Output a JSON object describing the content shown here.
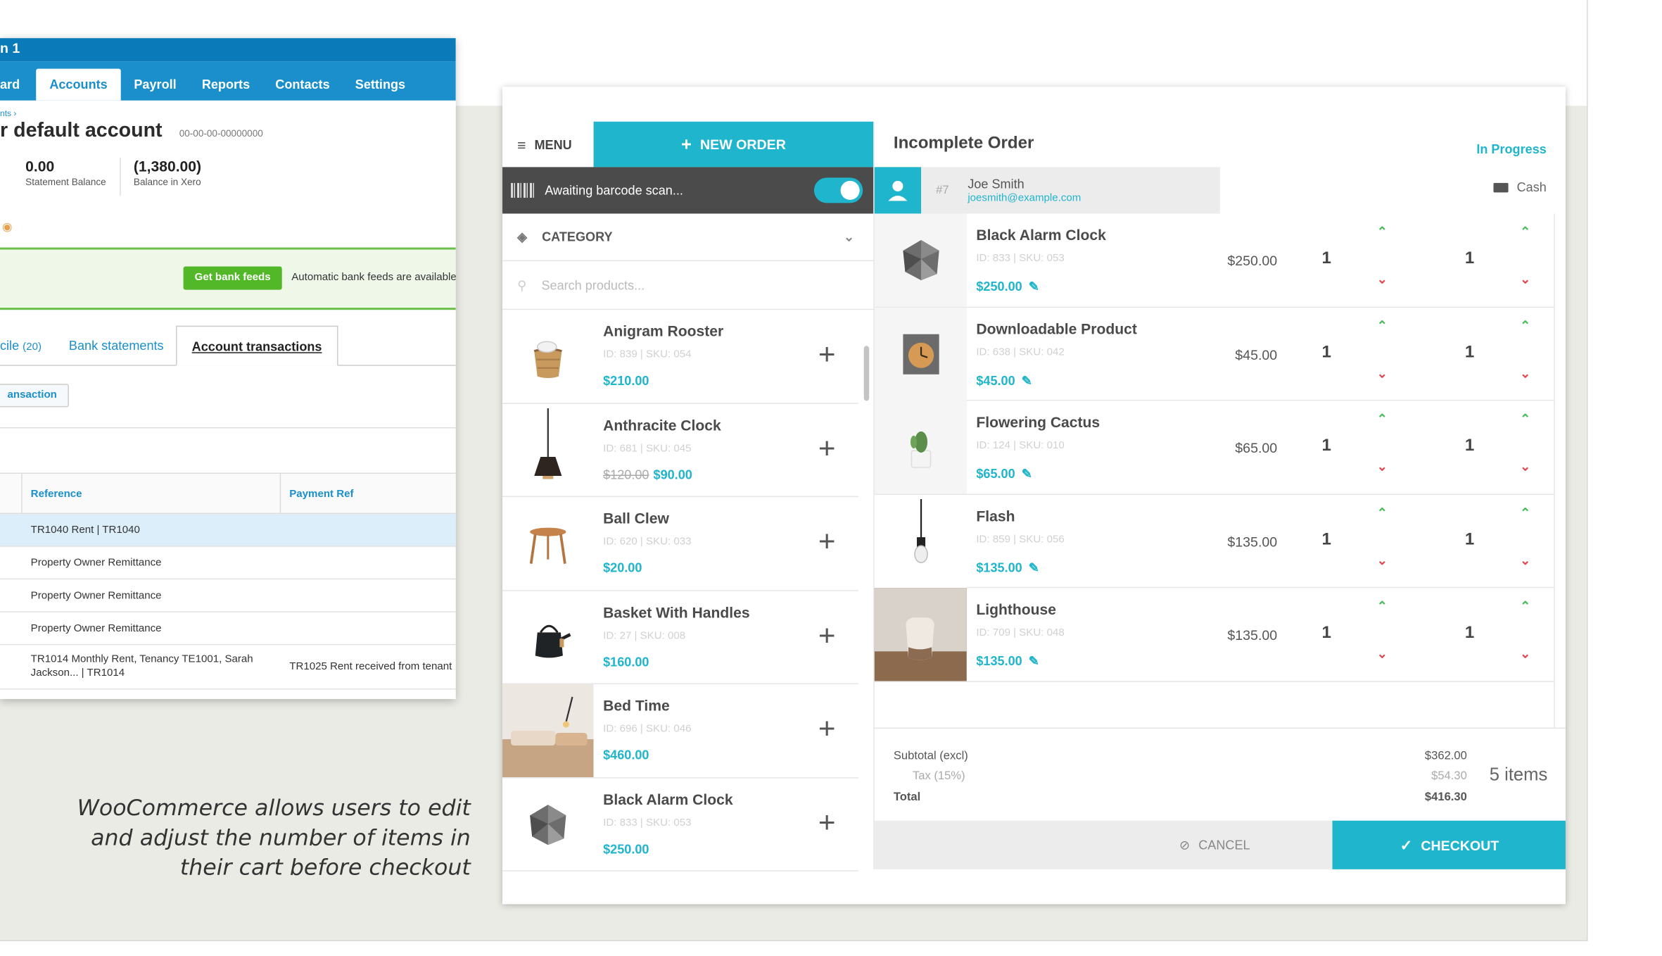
{
  "xero": {
    "window_title": "n 1",
    "nav": [
      "ard",
      "Accounts",
      "Payroll",
      "Reports",
      "Contacts",
      "Settings"
    ],
    "breadcrumb": "nts ›",
    "account_title": "r default account",
    "account_number": "00-00-00-00000000",
    "statement_balance": "0.00",
    "statement_balance_label": "Statement Balance",
    "xero_balance": "(1,380.00)",
    "xero_balance_label": "Balance in Xero",
    "feed_button": "Get bank feeds",
    "feed_text": "Automatic bank feeds are available",
    "tabs": {
      "reconcile": "cile",
      "reconcile_count": "(20)",
      "statements": "Bank statements",
      "transactions": "Account transactions"
    },
    "transaction_button": "ansaction",
    "table_headers": [
      "Reference",
      "Payment Ref"
    ],
    "rows": [
      {
        "reference": "TR1040 Rent | TR1040",
        "payment_ref": ""
      },
      {
        "reference": "Property Owner Remittance",
        "payment_ref": ""
      },
      {
        "reference": "Property Owner Remittance",
        "payment_ref": ""
      },
      {
        "reference": "Property Owner Remittance",
        "payment_ref": ""
      },
      {
        "reference": "TR1014 Monthly Rent, Tenancy TE1001, Sarah Jackson... | TR1014",
        "payment_ref": "TR1025 Rent received from tenant"
      }
    ]
  },
  "caption": [
    "WooCommerce allows users to edit",
    "and adjust the number of items in",
    "their cart before checkout"
  ],
  "pos": {
    "menu_label": "MENU",
    "new_order_label": "NEW ORDER",
    "scan_text": "Awaiting barcode scan...",
    "category_label": "CATEGORY",
    "search_placeholder": "Search products...",
    "products": [
      {
        "name": "Anigram Rooster",
        "meta": "ID: 839 | SKU: 054",
        "old_price": "",
        "price": "$210.00",
        "icon": "basket-chair"
      },
      {
        "name": "Anthracite Clock",
        "meta": "ID: 681 | SKU: 045",
        "old_price": "$120.00",
        "price": "$90.00",
        "icon": "pendant-lamp"
      },
      {
        "name": "Ball Clew",
        "meta": "ID: 620 | SKU: 033",
        "old_price": "",
        "price": "$20.00",
        "icon": "stool"
      },
      {
        "name": "Basket With Handles",
        "meta": "ID: 27 | SKU: 008",
        "old_price": "",
        "price": "$160.00",
        "icon": "kettle"
      },
      {
        "name": "Bed Time",
        "meta": "ID: 696 | SKU: 046",
        "old_price": "",
        "price": "$460.00",
        "icon": "bedroom"
      },
      {
        "name": "Black Alarm Clock",
        "meta": "ID: 833 | SKU: 053",
        "old_price": "",
        "price": "$250.00",
        "icon": "geometric-clock"
      }
    ],
    "order_title": "Incomplete Order",
    "order_status": "In Progress",
    "customer_number": "#7",
    "customer_name": "Joe Smith",
    "customer_email": "joesmith@example.com",
    "payment_method": "Cash",
    "lines": [
      {
        "name": "Black Alarm Clock",
        "meta": "ID: 833 | SKU: 053",
        "price": "$250.00",
        "unit_price": "$250.00",
        "qty_a": "1",
        "qty_b": "1",
        "icon": "geometric-clock"
      },
      {
        "name": "Downloadable Product",
        "meta": "ID: 638 | SKU: 042",
        "price": "$45.00",
        "unit_price": "$45.00",
        "qty_a": "1",
        "qty_b": "1",
        "icon": "wall-clock"
      },
      {
        "name": "Flowering Cactus",
        "meta": "ID: 124 | SKU: 010",
        "price": "$65.00",
        "unit_price": "$65.00",
        "qty_a": "1",
        "qty_b": "1",
        "icon": "cactus-pot"
      },
      {
        "name": "Flash",
        "meta": "ID: 859 | SKU: 056",
        "price": "$135.00",
        "unit_price": "$135.00",
        "qty_a": "1",
        "qty_b": "1",
        "icon": "bulb-lamp"
      },
      {
        "name": "Lighthouse",
        "meta": "ID: 709 | SKU: 048",
        "price": "$135.00",
        "unit_price": "$135.00",
        "qty_a": "1",
        "qty_b": "1",
        "icon": "ceramic-vase"
      }
    ],
    "subtotal_label": "Subtotal (excl)",
    "subtotal_value": "$362.00",
    "tax_label": "Tax (15%)",
    "tax_value": "$54.30",
    "total_label": "Total",
    "total_value": "$416.30",
    "item_count": "5 items",
    "cancel_label": "CANCEL",
    "checkout_label": "CHECKOUT"
  },
  "colors": {
    "accent": "#1fb5cc",
    "xero_blue": "#1a8fcb",
    "feed_green": "#52b827",
    "qty_up": "#4cbb5e",
    "qty_down": "#e2474f"
  }
}
